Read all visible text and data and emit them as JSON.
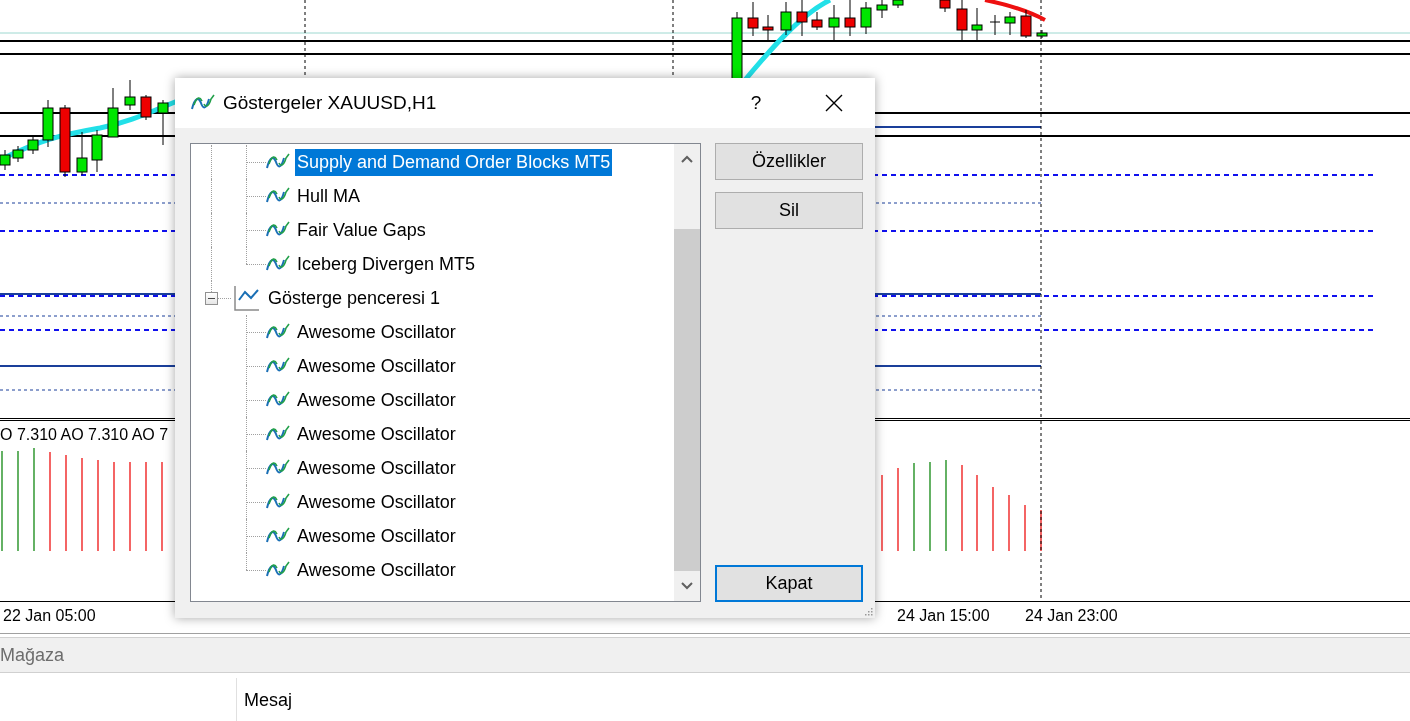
{
  "chart": {
    "subwindow_label": "O 7.310 AO 7.310 AO 7",
    "time_axis": [
      {
        "label": "22 Jan 05:00"
      },
      {
        "label": "24 Jan 15:00"
      },
      {
        "label": "24 Jan 23:00"
      }
    ]
  },
  "dialog": {
    "title": "Göstergeler XAUUSD,H1",
    "help": "?",
    "tree": [
      {
        "children": [
          {
            "label": "Supply and Demand Order Blocks MT5",
            "selected": true
          },
          {
            "label": "Hull MA",
            "selected": false
          },
          {
            "label": "Fair Value Gaps",
            "selected": false
          },
          {
            "label": "Iceberg Divergen MT5",
            "selected": false
          }
        ]
      },
      {
        "label": "Gösterge penceresi 1",
        "expanded": true,
        "children": [
          {
            "label": "Awesome Oscillator",
            "selected": false
          },
          {
            "label": "Awesome Oscillator",
            "selected": false
          },
          {
            "label": "Awesome Oscillator",
            "selected": false
          },
          {
            "label": "Awesome Oscillator",
            "selected": false
          },
          {
            "label": "Awesome Oscillator",
            "selected": false
          },
          {
            "label": "Awesome Oscillator",
            "selected": false
          },
          {
            "label": "Awesome Oscillator",
            "selected": false
          },
          {
            "label": "Awesome Oscillator",
            "selected": false
          }
        ]
      }
    ],
    "buttons": [
      {
        "label": "Özellikler",
        "default": false
      },
      {
        "label": "Sil",
        "default": false
      },
      {
        "label": "Kapat",
        "default": true
      }
    ]
  },
  "toolbox": {
    "tab": "Mağaza",
    "columns": [
      "Mesaj"
    ]
  }
}
